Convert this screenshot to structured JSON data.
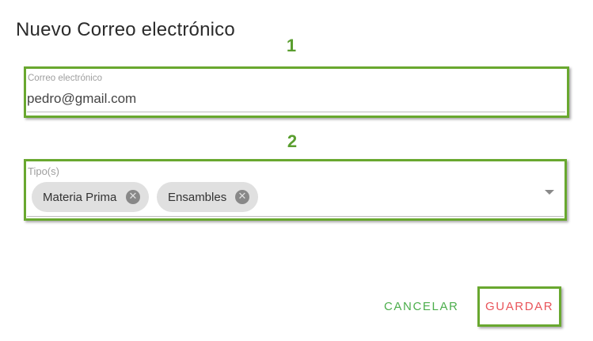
{
  "dialog": {
    "title": "Nuevo Correo electrónico"
  },
  "annotations": {
    "step1": "1",
    "step2": "2",
    "highlight_color": "#69a82f"
  },
  "email_field": {
    "label": "Correo electrónico",
    "value": "pedro@gmail.com"
  },
  "types_field": {
    "label": "Tipo(s)",
    "chips": [
      {
        "label": "Materia Prima",
        "remove_icon": "cancel-circle-icon"
      },
      {
        "label": "Ensambles",
        "remove_icon": "cancel-circle-icon"
      }
    ],
    "dropdown_icon": "caret-down-icon"
  },
  "actions": {
    "cancel_label": "CANCELAR",
    "save_label": "GUARDAR",
    "cancel_color": "#4cae4c",
    "save_color": "#e9545a"
  }
}
